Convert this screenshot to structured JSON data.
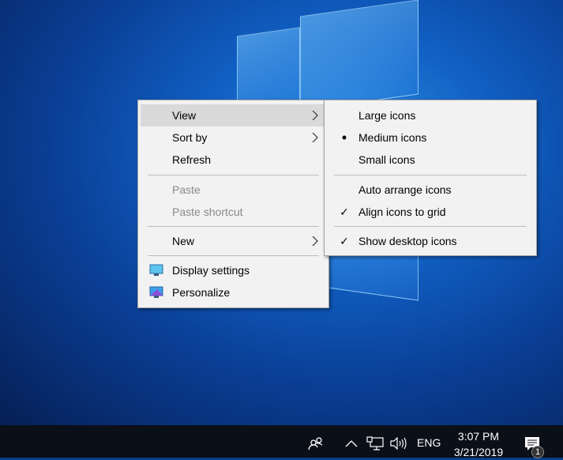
{
  "context_menu": {
    "items": [
      {
        "label": "View",
        "submenu": true,
        "highlighted": true
      },
      {
        "label": "Sort by",
        "submenu": true
      },
      {
        "label": "Refresh"
      },
      {
        "label": "Paste",
        "disabled": true
      },
      {
        "label": "Paste shortcut",
        "disabled": true
      },
      {
        "label": "New",
        "submenu": true
      },
      {
        "label": "Display settings",
        "icon": "display-icon"
      },
      {
        "label": "Personalize",
        "icon": "personalize-icon"
      }
    ]
  },
  "view_submenu": {
    "items": [
      {
        "label": "Large icons"
      },
      {
        "label": "Medium icons",
        "mark": "•"
      },
      {
        "label": "Small icons"
      },
      {
        "label": "Auto arrange icons"
      },
      {
        "label": "Align icons to grid",
        "mark": "✓"
      },
      {
        "label": "Show desktop icons",
        "mark": "✓"
      }
    ]
  },
  "taskbar": {
    "language": "ENG",
    "time": "3:07 PM",
    "date": "3/21/2019",
    "notification_count": "1"
  }
}
